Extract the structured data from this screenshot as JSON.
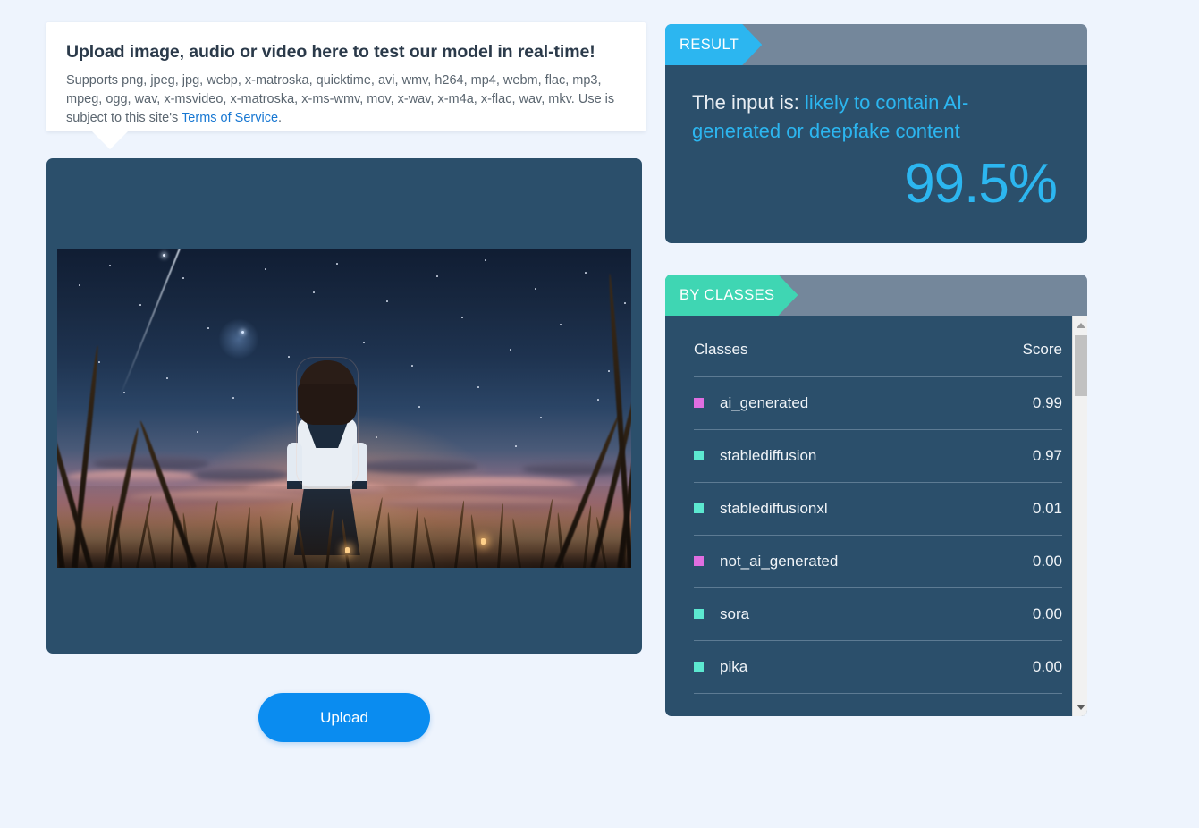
{
  "background_color": "#eef4fd",
  "upload_card": {
    "title": "Upload image, audio or video here to test our model in real-time!",
    "supports_text": "Supports png, jpeg, jpg, webp, x-matroska, quicktime, avi, wmv, h264, mp4, webm, flac, mp3, mpeg, ogg, wav, x-msvideo, x-matroska, x-ms-wmv, mov, x-wav, x-m4a, x-flac, wav, mkv. Use is subject to this site's ",
    "tos_link": "Terms of Service",
    "period": "."
  },
  "preview": {
    "alt": "anime illustration of a girl in a school uniform standing in tall grass facing a starry sunset sky"
  },
  "upload_button": {
    "label": "Upload"
  },
  "result_panel": {
    "ribbon_label": "RESULT",
    "ribbon_color": "#2cb6f0",
    "prefix": "The input is: ",
    "verdict": "likely to contain AI-generated or deepfake content",
    "percent": "99.5%",
    "accent_color": "#2cb6f0",
    "body_color": "#2b4f6b",
    "header_color": "#74879b"
  },
  "classes_panel": {
    "ribbon_label": "BY CLASSES",
    "ribbon_color": "#3fd6b3",
    "columns": [
      "Classes",
      "Score"
    ],
    "rows": [
      {
        "label": "ai_generated",
        "score": "0.99",
        "color": "#e06ee0"
      },
      {
        "label": "stablediffusion",
        "score": "0.97",
        "color": "#5ce8d0"
      },
      {
        "label": "stablediffusionxl",
        "score": "0.01",
        "color": "#5ce8d0"
      },
      {
        "label": "not_ai_generated",
        "score": "0.00",
        "color": "#e06ee0"
      },
      {
        "label": "sora",
        "score": "0.00",
        "color": "#5ce8d0"
      },
      {
        "label": "pika",
        "score": "0.00",
        "color": "#5ce8d0"
      }
    ],
    "scrollbar": {
      "up_icon": "triangle-up-icon",
      "down_icon": "triangle-down-icon"
    }
  }
}
